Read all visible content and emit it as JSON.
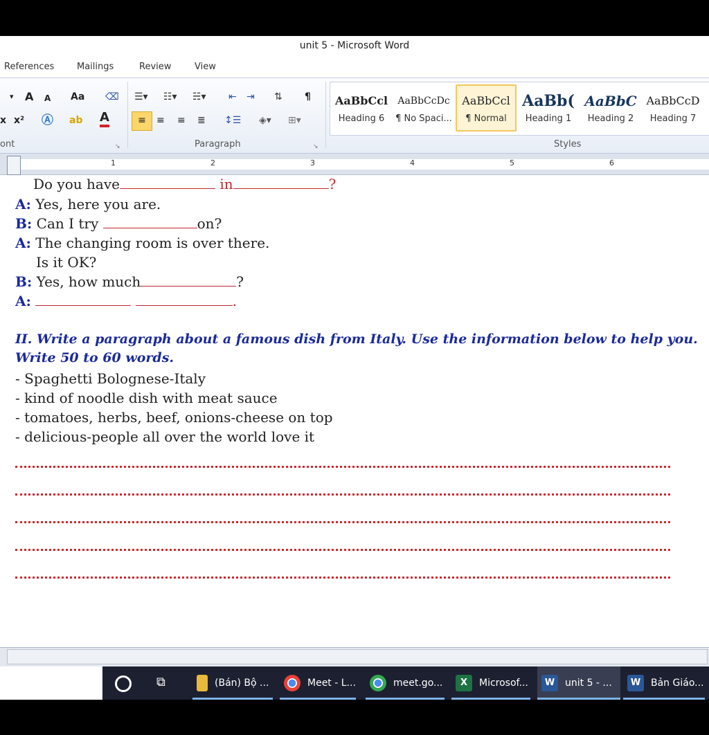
{
  "window": {
    "title": "unit 5 - Microsoft Word"
  },
  "tabs": [
    "References",
    "Mailings",
    "Review",
    "View"
  ],
  "ribbon": {
    "groups": {
      "font": "ont",
      "paragraph": "Paragraph",
      "styles": "Styles"
    },
    "font_buttons": {
      "grow": "A",
      "shrink": "A",
      "case": "Aa",
      "sub": "x",
      "sup": "x²",
      "color": "A"
    },
    "pilcrow": "¶",
    "styles": [
      {
        "preview": "AaBbCcl",
        "name": "Heading 6"
      },
      {
        "preview": "AaBbCcDc",
        "name": "¶ No Spaci..."
      },
      {
        "preview": "AaBbCcl",
        "name": "¶ Normal",
        "selected": true
      },
      {
        "preview": "AaBb(",
        "name": "Heading 1"
      },
      {
        "preview": "AaBbC",
        "name": "Heading 2"
      },
      {
        "preview": "AaBbCcD",
        "name": "Heading 7"
      }
    ]
  },
  "ruler": {
    "numbers": [
      "1",
      "2",
      "3",
      "4",
      "5",
      "6"
    ]
  },
  "document": {
    "dialogue": [
      {
        "speaker": "",
        "pre": "Do you have",
        "mid": "in",
        "post": "?"
      },
      {
        "speaker": "A:",
        "text": "Yes, here you are."
      },
      {
        "speaker": "B:",
        "pre": "Can I try",
        "post": "on?"
      },
      {
        "speaker": "A:",
        "text": "The changing room is over there."
      },
      {
        "speaker": "",
        "text": "Is it OK?"
      },
      {
        "speaker": "B:",
        "pre": "Yes, how much",
        "post": "?"
      },
      {
        "speaker": "A:",
        "post": "."
      }
    ],
    "section2": {
      "heading_line1": "II. Write a paragraph about a famous dish from Italy. Use the information below to help you.",
      "heading_line2": "Write 50 to 60 words.",
      "bullets": [
        "- Spaghetti Bolognese-Italy",
        "- kind of noodle dish with meat sauce",
        "- tomatoes, herbs, beef, onions-cheese on top",
        "- delicious-people all over the world love it"
      ]
    }
  },
  "taskbar": {
    "items": [
      {
        "label": "(Bán) Bộ ...",
        "icon": "folder-icon"
      },
      {
        "label": "Meet - L...",
        "icon": "chrome-icon"
      },
      {
        "label": "meet.go...",
        "icon": "chrome-icon"
      },
      {
        "label": "Microsof...",
        "icon": "excel-icon"
      },
      {
        "label": "unit 5 - ...",
        "icon": "word-icon"
      },
      {
        "label": "Bản Giáo...",
        "icon": "word-icon"
      }
    ]
  },
  "colors": {
    "accent_blue": "#1a2a9c",
    "red": "#c0282e",
    "taskbar": "#1c2030"
  }
}
